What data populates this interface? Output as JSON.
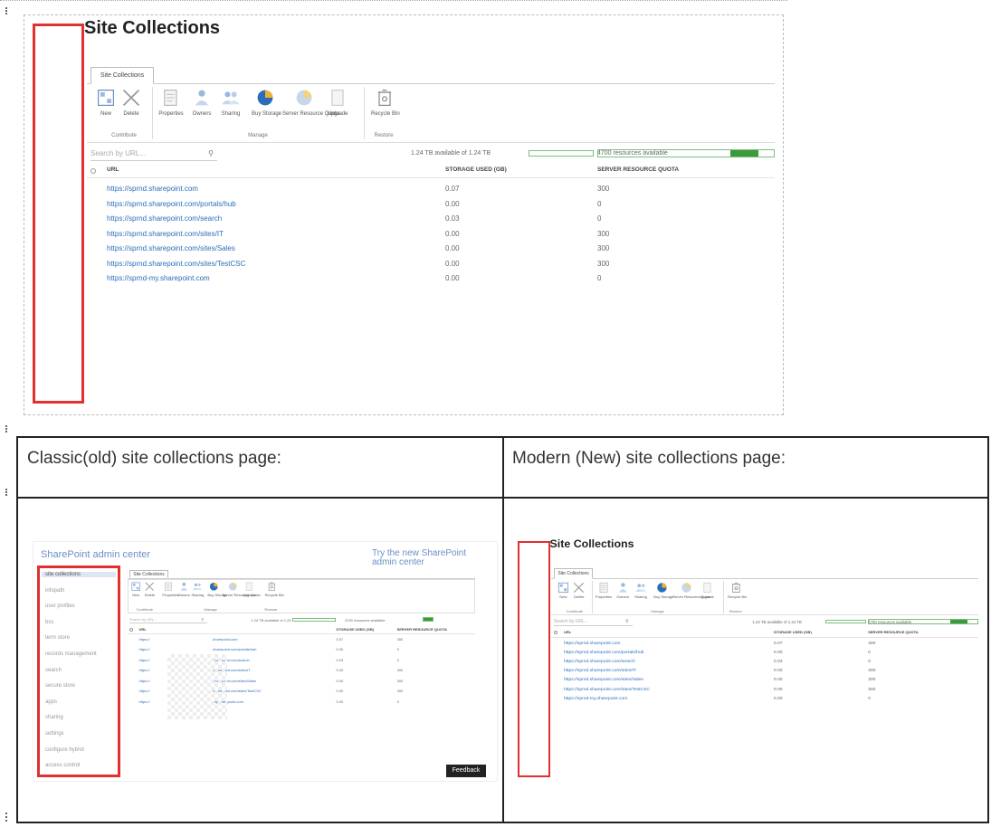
{
  "main_panel": {
    "title": "Site Collections",
    "tab": "Site Collections",
    "ribbon": {
      "buttons": [
        {
          "label": "New",
          "icon": "new-site-icon"
        },
        {
          "label": "Delete",
          "icon": "delete-x-icon"
        },
        {
          "label": "Properties",
          "icon": "properties-icon"
        },
        {
          "label": "Owners",
          "icon": "owners-icon"
        },
        {
          "label": "Sharing",
          "icon": "sharing-icon"
        },
        {
          "label": "Buy Storage",
          "icon": "buy-storage-icon"
        },
        {
          "label": "Server Resource Quota",
          "icon": "server-resource-quota-icon"
        },
        {
          "label": "Upgrade",
          "icon": "upgrade-icon"
        },
        {
          "label": "Recycle Bin",
          "icon": "recycle-bin-icon"
        }
      ],
      "groups": [
        "Contribute",
        "Manage",
        "Restore"
      ]
    },
    "search_placeholder": "Search by URL...",
    "storage_info": "1.24 TB available of 1.24 TB",
    "storage_used_fraction": 0.0,
    "resources_info": "4700 resources available",
    "resources_fraction": 0.16,
    "columns": [
      "URL",
      "STORAGE USED (GB)",
      "SERVER RESOURCE QUOTA"
    ],
    "rows": [
      {
        "url": "https://sprnd.sharepoint.com",
        "storage": "0.07",
        "quota": "300"
      },
      {
        "url": "https://sprnd.sharepoint.com/portals/hub",
        "storage": "0.00",
        "quota": "0"
      },
      {
        "url": "https://sprnd.sharepoint.com/search",
        "storage": "0.03",
        "quota": "0"
      },
      {
        "url": "https://sprnd.sharepoint.com/sites/IT",
        "storage": "0.00",
        "quota": "300"
      },
      {
        "url": "https://sprnd.sharepoint.com/sites/Sales",
        "storage": "0.00",
        "quota": "300"
      },
      {
        "url": "https://sprnd.sharepoint.com/sites/TestCSC",
        "storage": "0.00",
        "quota": "300"
      },
      {
        "url": "https://sprnd-my.sharepoint.com",
        "storage": "0.00",
        "quota": "0"
      }
    ]
  },
  "comparison_table": {
    "classic_caption": "Classic(old) site collections page:",
    "modern_caption": "Modern (New) site collections page:"
  },
  "classic_page": {
    "admin_title": "SharePoint admin center",
    "try_new": "Try the new SharePoint admin center",
    "nav_items": [
      "site collections",
      "infopath",
      "user profiles",
      "bcs",
      "term store",
      "records management",
      "search",
      "secure store",
      "apps",
      "sharing",
      "settings",
      "configure hybrid",
      "access control"
    ],
    "row_urls": [
      {
        "pre": "https://",
        "post": ".sharepoint.com"
      },
      {
        "pre": "https://",
        "post": ".sharepoint.com/portals/hub"
      },
      {
        "pre": "https://",
        "post": ".sharepoint.com/search"
      },
      {
        "pre": "https://",
        "post": ".sharepoint.com/sites/IT"
      },
      {
        "pre": "https://",
        "post": ".sharepoint.com/sites/Sales"
      },
      {
        "pre": "https://",
        "post": ".sharepoint.com/sites/TestCSC"
      },
      {
        "pre": "https://",
        "post": "-my.sharepoint.com"
      }
    ],
    "feedback": "Feedback"
  },
  "colors": {
    "highlight": "#e03030",
    "link": "#2a6ebb",
    "bar": "#3b9a3b"
  }
}
